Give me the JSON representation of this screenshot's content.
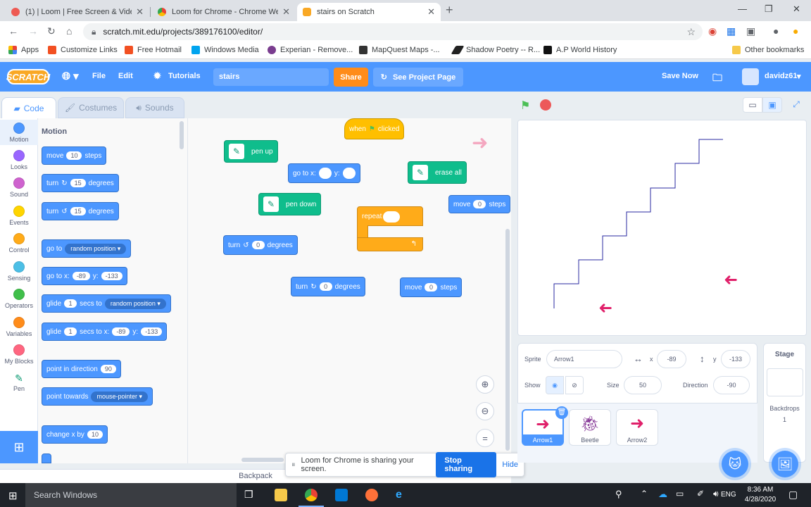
{
  "browser": {
    "tabs": [
      {
        "title": "(1) | Loom | Free Screen & Video"
      },
      {
        "title": "Loom for Chrome - Chrome Web"
      },
      {
        "title": "stairs on Scratch"
      }
    ],
    "url": "scratch.mit.edu/projects/389176100/editor/",
    "bookmarks": [
      "Apps",
      "Customize Links",
      "Free Hotmail",
      "Windows Media",
      "Experian - Remove...",
      "MapQuest Maps -...",
      "Shadow Poetry -- R...",
      "A.P World History"
    ],
    "other_bookmarks": "Other bookmarks"
  },
  "menu": {
    "logo": "SCRATCH",
    "file": "File",
    "edit": "Edit",
    "tutorials": "Tutorials",
    "project_title": "stairs",
    "share": "Share",
    "see_project": "See Project Page",
    "save_now": "Save Now",
    "username": "davidz61"
  },
  "editor_tabs": {
    "code": "Code",
    "costumes": "Costumes",
    "sounds": "Sounds"
  },
  "categories": [
    {
      "label": "Motion",
      "color": "#4c97ff"
    },
    {
      "label": "Looks",
      "color": "#9966ff"
    },
    {
      "label": "Sound",
      "color": "#cf63cf"
    },
    {
      "label": "Events",
      "color": "#ffd500"
    },
    {
      "label": "Control",
      "color": "#ffab19"
    },
    {
      "label": "Sensing",
      "color": "#4cbfe6"
    },
    {
      "label": "Operators",
      "color": "#40bf4a"
    },
    {
      "label": "Variables",
      "color": "#ff8c1a"
    },
    {
      "label": "My Blocks",
      "color": "#ff6680"
    },
    {
      "label": "Pen",
      "color": "#0fbd8c"
    }
  ],
  "palette": {
    "heading": "Motion",
    "move": {
      "a": "move",
      "v": "10",
      "b": "steps"
    },
    "turn_right": {
      "a": "turn",
      "v": "15",
      "b": "degrees"
    },
    "turn_left": {
      "a": "turn",
      "v": "15",
      "b": "degrees"
    },
    "goto_random": {
      "a": "go to",
      "opt": "random position"
    },
    "goto_xy": {
      "a": "go to x:",
      "x": "-89",
      "b": "y:",
      "y": "-133"
    },
    "glide_random": {
      "a": "glide",
      "v": "1",
      "b": "secs to",
      "opt": "random position"
    },
    "glide_xy": {
      "a": "glide",
      "v": "1",
      "b": "secs to x:",
      "x": "-89",
      "c": "y:",
      "y": "-133"
    },
    "point_dir": {
      "a": "point in direction",
      "v": "90"
    },
    "point_towards": {
      "a": "point towards",
      "opt": "mouse-pointer"
    },
    "change_x": {
      "a": "change x by",
      "v": "10"
    }
  },
  "workspace": {
    "when_flag": {
      "a": "when",
      "b": "clicked"
    },
    "pen_up": "pen up",
    "goto": {
      "a": "go to x:",
      "b": "y:"
    },
    "erase_all": "erase all",
    "pen_down": "pen down",
    "move_right": {
      "a": "move",
      "v": "0",
      "b": "steps"
    },
    "repeat": "repeat",
    "turn_left": {
      "a": "turn",
      "v": "0",
      "b": "degrees"
    },
    "turn_right": {
      "a": "turn",
      "v": "0",
      "b": "degrees"
    },
    "move_bottom": {
      "a": "move",
      "v": "0",
      "b": "steps"
    }
  },
  "backpack": "Backpack",
  "loom": {
    "message": "Loom for Chrome is sharing your screen.",
    "stop": "Stop sharing",
    "hide": "Hide"
  },
  "sprite_info": {
    "sprite_label": "Sprite",
    "sprite_name": "Arrow1",
    "x_label": "x",
    "x": "-89",
    "y_label": "y",
    "y": "-133",
    "show_label": "Show",
    "size_label": "Size",
    "size": "50",
    "direction_label": "Direction",
    "direction": "-90"
  },
  "sprites": [
    {
      "name": "Arrow1",
      "selected": true
    },
    {
      "name": "Beetle",
      "selected": false
    },
    {
      "name": "Arrow2",
      "selected": false
    }
  ],
  "stage_panel": {
    "title": "Stage",
    "backdrops_label": "Backdrops",
    "backdrops_count": "1"
  },
  "taskbar": {
    "search": "Search Windows",
    "lang": "ENG",
    "time": "8:36 AM",
    "date": "4/28/2020"
  }
}
